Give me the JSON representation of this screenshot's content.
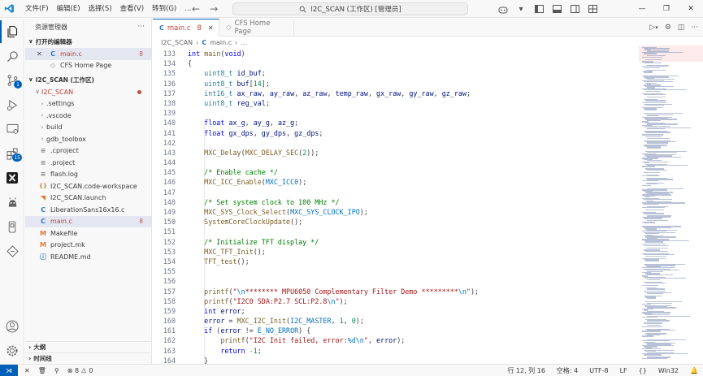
{
  "title_bar": {
    "menus": [
      "文件(F)",
      "编辑(E)",
      "选择(S)",
      "查看(V)",
      "转到(G)",
      "..."
    ],
    "search_text": "I2C_SCAN (工作区) [管理员]"
  },
  "sidebar": {
    "title": "资源管理器",
    "open_editors_label": "打开的编辑器",
    "open_editors": [
      {
        "name": "main.c",
        "count": "8"
      },
      {
        "name": "CFS Home Page",
        "count": ""
      }
    ],
    "workspace_label": "I2C_SCAN (工作区)",
    "root_folder": "I2C_SCAN",
    "files": [
      {
        "name": ".settings",
        "type": "folder"
      },
      {
        "name": ".vscode",
        "type": "folder"
      },
      {
        "name": "build",
        "type": "folder"
      },
      {
        "name": "gdb_toolbox",
        "type": "folder"
      },
      {
        "name": ".cproject",
        "type": "file"
      },
      {
        "name": ".project",
        "type": "file"
      },
      {
        "name": "flash.log",
        "type": "file"
      },
      {
        "name": "I2C_SCAN.code-workspace",
        "type": "json"
      },
      {
        "name": "I2C_SCAN.launch",
        "type": "launch"
      },
      {
        "name": "LiberationSans16x16.c",
        "type": "c"
      },
      {
        "name": "main.c",
        "type": "c",
        "count": "8"
      },
      {
        "name": "Makefile",
        "type": "make"
      },
      {
        "name": "project.mk",
        "type": "make"
      },
      {
        "name": "README.md",
        "type": "info"
      }
    ],
    "outline_label": "大纲",
    "timeline_label": "时间线"
  },
  "tabs": [
    {
      "label": "main.c",
      "count": "8"
    },
    {
      "label": "CFS Home Page"
    }
  ],
  "breadcrumb": {
    "folder": "I2C_SCAN",
    "file": "main.c",
    "more": "..."
  },
  "code_lines": [
    {
      "n": "133",
      "html": "<span class='kw'>int</span> <span class='fn'>main</span>(<span class='kw'>void</span>)"
    },
    {
      "n": "134",
      "html": "{"
    },
    {
      "n": "135",
      "html": "    <span class='ty'>uint8_t</span> <span class='vr'>id_buf</span>;"
    },
    {
      "n": "136",
      "html": "    <span class='ty'>uint8_t</span> <span class='vr'>buf</span>[<span class='nm'>14</span>];"
    },
    {
      "n": "137",
      "html": "    <span class='ty'>int16_t</span> <span class='vr'>ax_raw</span>, <span class='vr'>ay_raw</span>, <span class='vr'>az_raw</span>, <span class='vr'>temp_raw</span>, <span class='vr'>gx_raw</span>, <span class='vr'>gy_raw</span>, <span class='vr'>gz_raw</span>;"
    },
    {
      "n": "138",
      "html": "    <span class='ty'>uint8_t</span> <span class='vr'>reg_val</span>;"
    },
    {
      "n": "139",
      "html": ""
    },
    {
      "n": "140",
      "html": "    <span class='kw'>float</span> <span class='vr'>ax_g</span>, <span class='vr'>ay_g</span>, <span class='vr'>az_g</span>;"
    },
    {
      "n": "141",
      "html": "    <span class='kw'>float</span> <span class='vr'>gx_dps</span>, <span class='vr'>gy_dps</span>, <span class='vr'>gz_dps</span>;"
    },
    {
      "n": "142",
      "html": ""
    },
    {
      "n": "143",
      "html": "    <span class='fn'>MXC_Delay</span>(<span class='fn'>MXC_DELAY_SEC</span>(<span class='nm'>2</span>));"
    },
    {
      "n": "144",
      "html": ""
    },
    {
      "n": "145",
      "html": "    <span class='cm'>/* Enable cache */</span>"
    },
    {
      "n": "146",
      "html": "    <span class='fn'>MXC_ICC_Enable</span>(<span class='mc'>MXC_ICC0</span>);"
    },
    {
      "n": "147",
      "html": ""
    },
    {
      "n": "148",
      "html": "    <span class='cm'>/* Set system clock to 100 MHz */</span>"
    },
    {
      "n": "149",
      "html": "    <span class='fn'>MXC_SYS_Clock_Select</span>(<span class='mc'>MXC_SYS_CLOCK_IPO</span>);"
    },
    {
      "n": "150",
      "html": "    <span class='fn'>SystemCoreClockUpdate</span>();"
    },
    {
      "n": "151",
      "html": ""
    },
    {
      "n": "152",
      "html": "    <span class='cm'>/* Initialize TFT display */</span>"
    },
    {
      "n": "153",
      "html": "    <span class='fn'>MXC_TFT_Init</span>();"
    },
    {
      "n": "154",
      "html": "    <span class='fn'>TFT_test</span>();"
    },
    {
      "n": "155",
      "html": ""
    },
    {
      "n": "156",
      "html": ""
    },
    {
      "n": "157",
      "html": "    <span class='fn'>printf</span>(<span class='st'>\"</span><span class='mc'>\\n</span><span class='st'>******** MPU6050 Complementary Filter Demo *********</span><span class='mc'>\\n</span><span class='st'>\"</span>);"
    },
    {
      "n": "158",
      "html": "    <span class='fn'>printf</span>(<span class='st'>\"I2C0 SDA:P2.7 SCL:P2.8</span><span class='mc'>\\n</span><span class='st'>\"</span>);"
    },
    {
      "n": "159",
      "html": "    <span class='kw'>int</span> <span class='vr'>error</span>;"
    },
    {
      "n": "160",
      "html": "    <span class='vr'>error</span> = <span class='fn'>MXC_I2C_Init</span>(<span class='mc'>I2C_MASTER</span>, <span class='nm'>1</span>, <span class='nm'>0</span>);"
    },
    {
      "n": "161",
      "html": "    <span class='kw'>if</span> (<span class='vr'>error</span> != <span class='mc'>E_NO_ERROR</span>) {"
    },
    {
      "n": "162",
      "html": "        <span class='fn'>printf</span>(<span class='st'>\"I2C Init failed, error:</span><span class='mc'>%d</span><span class='mc'>\\n</span><span class='st'>\"</span>, <span class='vr'>error</span>);"
    },
    {
      "n": "163",
      "html": "        <span class='kw'>return</span> <span class='nm'>-1</span>;"
    },
    {
      "n": "164",
      "html": "    }"
    }
  ],
  "status_bar": {
    "errors": "8",
    "warnings": "0",
    "position": "行 12, 列 16",
    "spaces": "空格: 4",
    "encoding": "UTF-8",
    "eol": "LF",
    "language": "Win32"
  },
  "colors": {
    "accent": "#005fb8",
    "error": "#c24038"
  }
}
